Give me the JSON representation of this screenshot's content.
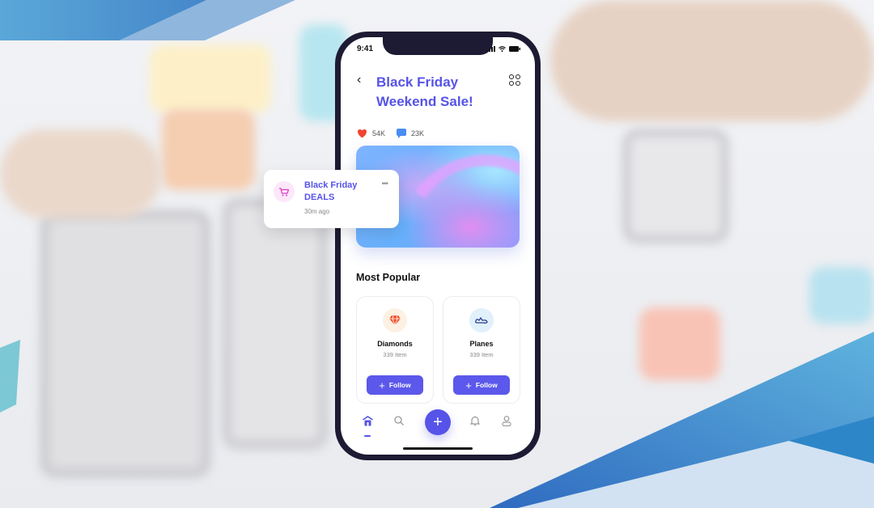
{
  "status_bar": {
    "time": "9:41"
  },
  "header": {
    "title_line1": "Black Friday",
    "title_line2": "Weekend Sale!",
    "back_label": "‹"
  },
  "stats": {
    "likes": "54K",
    "comments": "23K"
  },
  "notification": {
    "title_line1": "Black Friday",
    "title_line2": "DEALS",
    "time_ago": "30m ago",
    "more_label": "•••"
  },
  "section": {
    "title": "Most Popular"
  },
  "cards": [
    {
      "name": "Diamonds",
      "count": "339 Item",
      "button": "Follow",
      "icon": "diamond-icon"
    },
    {
      "name": "Planes",
      "count": "339 Item",
      "button": "Follow",
      "icon": "plane-icon"
    }
  ],
  "nav": {
    "items": [
      "home-icon",
      "search-icon",
      "plus-icon",
      "bell-icon",
      "user-icon"
    ],
    "fab_label": "+",
    "active": "home"
  },
  "colors": {
    "accent": "#5653e8",
    "heart": "#f04430",
    "chat": "#4a8df5",
    "phone_frame": "#1d1b33"
  }
}
